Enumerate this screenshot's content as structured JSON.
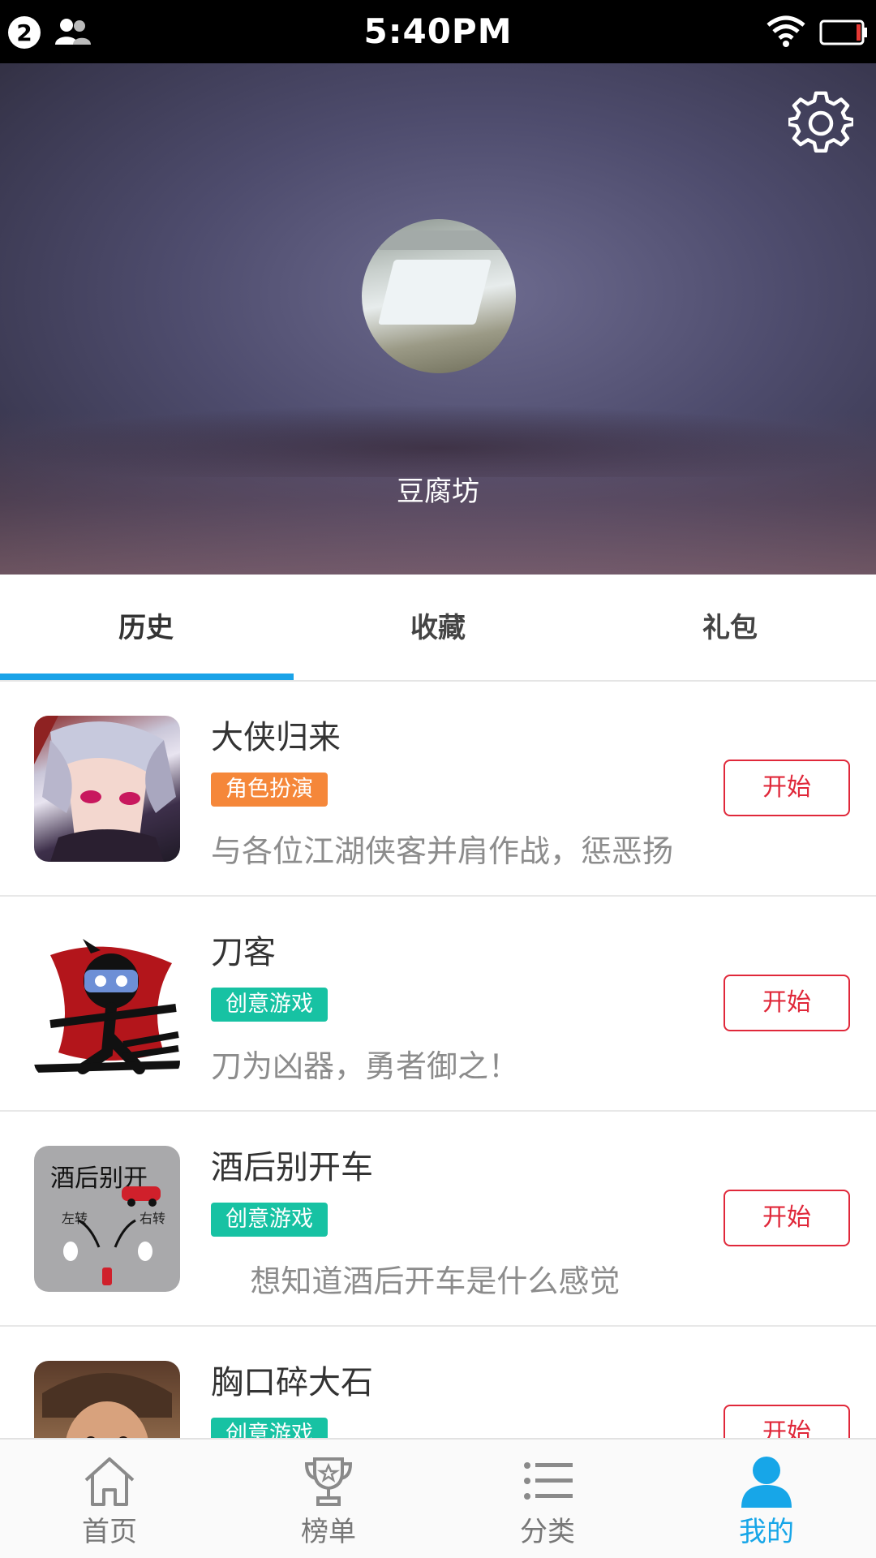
{
  "status_bar": {
    "notification_count": "2",
    "time": "5:40PM",
    "icons": [
      "people-icon",
      "wifi-icon",
      "battery-icon"
    ]
  },
  "profile": {
    "username": "豆腐坊",
    "settings_icon": "gear-icon"
  },
  "tabs": [
    {
      "label": "历史",
      "active": true
    },
    {
      "label": "收藏",
      "active": false
    },
    {
      "label": "礼包",
      "active": false
    }
  ],
  "games": [
    {
      "title": "大侠归来",
      "tag": "角色扮演",
      "tag_color": "#f5873a",
      "description": "与各位江湖侠客并肩作战，惩恶扬",
      "button": "开始"
    },
    {
      "title": "刀客",
      "tag": "创意游戏",
      "tag_color": "#17c2a3",
      "description": "刀为凶器，勇者御之！",
      "button": "开始"
    },
    {
      "title": "酒后别开车",
      "tag": "创意游戏",
      "tag_color": "#17c2a3",
      "description": "    想知道酒后开车是什么感觉",
      "button": "开始"
    },
    {
      "title": "胸口碎大石",
      "tag": "创意游戏",
      "tag_color": "#17c2a3",
      "description": "",
      "button": "开始"
    }
  ],
  "drunk_icon_text": {
    "title": "酒后别开",
    "left": "左转",
    "right": "右转"
  },
  "bottom_nav": [
    {
      "label": "首页",
      "icon": "home-icon",
      "active": false
    },
    {
      "label": "榜单",
      "icon": "trophy-icon",
      "active": false
    },
    {
      "label": "分类",
      "icon": "list-icon",
      "active": false
    },
    {
      "label": "我的",
      "icon": "person-icon",
      "active": true
    }
  ],
  "colors": {
    "accent": "#1aa3e8",
    "start_button": "#e0283a",
    "tag_orange": "#f5873a",
    "tag_green": "#17c2a3"
  }
}
